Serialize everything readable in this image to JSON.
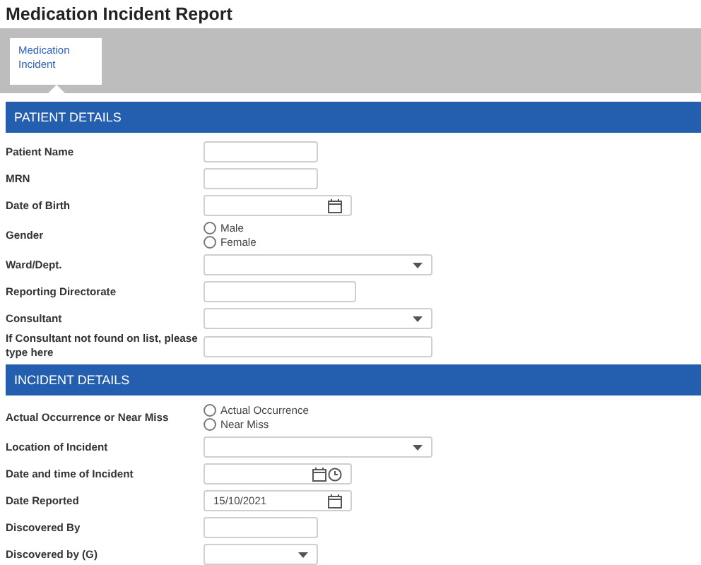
{
  "title": "Medication Incident Report",
  "tabs": [
    {
      "label": "Medication Incident",
      "selected": true
    }
  ],
  "sections": [
    {
      "heading": "PATIENT DETAILS",
      "fields": [
        {
          "label": "Patient Name",
          "kind": "text"
        },
        {
          "label": "MRN",
          "kind": "text"
        },
        {
          "label": "Date of Birth",
          "kind": "date"
        },
        {
          "label": "Gender",
          "kind": "radio",
          "options": [
            {
              "label": "Male",
              "selected": false
            },
            {
              "label": "Female",
              "selected": false
            }
          ]
        },
        {
          "label": "Ward/Dept.",
          "kind": "select"
        },
        {
          "label": "Reporting Directorate",
          "kind": "text"
        },
        {
          "label": "Consultant",
          "kind": "select"
        },
        {
          "label": "If Consultant not found on list, please type here",
          "kind": "text"
        }
      ]
    },
    {
      "heading": "INCIDENT DETAILS",
      "fields": [
        {
          "label": "Actual Occurrence or Near Miss",
          "kind": "radio",
          "options": [
            {
              "label": "Actual Occurrence",
              "selected": false
            },
            {
              "label": "Near Miss",
              "selected": false
            }
          ]
        },
        {
          "label": "Location of Incident",
          "kind": "select"
        },
        {
          "label": "Date and time of Incident",
          "kind": "datetime"
        },
        {
          "label": "Date Reported",
          "kind": "date",
          "value": "15/10/2021"
        },
        {
          "label": "Discovered By",
          "kind": "text"
        },
        {
          "label": "Discovered by (G)",
          "kind": "select"
        }
      ]
    }
  ]
}
